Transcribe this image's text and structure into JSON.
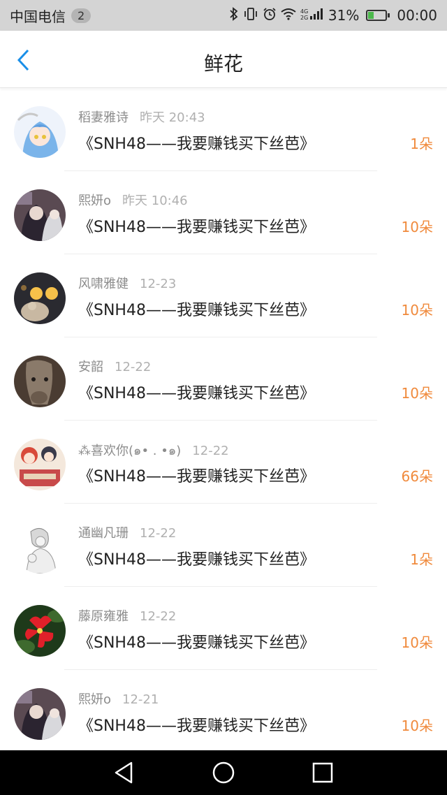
{
  "status_bar": {
    "carrier": "中国电信",
    "notification_count": "2",
    "battery_percent": "31%",
    "battery_level": 0.31,
    "time": "00:00"
  },
  "header": {
    "title": "鲜花"
  },
  "items": [
    {
      "name": "稻妻雅诗",
      "date": "昨天 20:43",
      "book": "《SNH48——我要赚钱买下丝芭》",
      "count": "1朵",
      "avatar": "anime-girl-blue-hair"
    },
    {
      "name": "熙妍o",
      "date": "昨天 10:46",
      "book": "《SNH48——我要赚钱买下丝芭》",
      "count": "10朵",
      "avatar": "anime-character-dark"
    },
    {
      "name": "风啸雅健",
      "date": "12-23",
      "book": "《SNH48——我要赚钱买下丝芭》",
      "count": "10朵",
      "avatar": "teddy-bear-lights"
    },
    {
      "name": "安韶",
      "date": "12-22",
      "book": "《SNH48——我要赚钱买下丝芭》",
      "count": "10朵",
      "avatar": "animal-photo"
    },
    {
      "name": "⁂喜欢你(๑• . •๑)",
      "date": "12-22",
      "book": "《SNH48——我要赚钱买下丝芭》",
      "count": "66朵",
      "avatar": "anime-group"
    },
    {
      "name": "通幽凡珊",
      "date": "12-22",
      "book": "《SNH48——我要赚钱买下丝芭》",
      "count": "1朵",
      "avatar": "sketch-girl"
    },
    {
      "name": "藤原雍雅",
      "date": "12-22",
      "book": "《SNH48——我要赚钱买下丝芭》",
      "count": "10朵",
      "avatar": "red-flower"
    },
    {
      "name": "熙妍o",
      "date": "12-21",
      "book": "《SNH48——我要赚钱买下丝芭》",
      "count": "10朵",
      "avatar": "anime-character-dark"
    }
  ],
  "colors": {
    "accent": "#1a8fe8",
    "count": "#f08a3c",
    "status_bar": "#d4d4d4",
    "system_nav": "#000000"
  },
  "system_nav": {
    "icons": [
      "back-triangle-icon",
      "home-circle-icon",
      "recents-square-icon"
    ]
  }
}
